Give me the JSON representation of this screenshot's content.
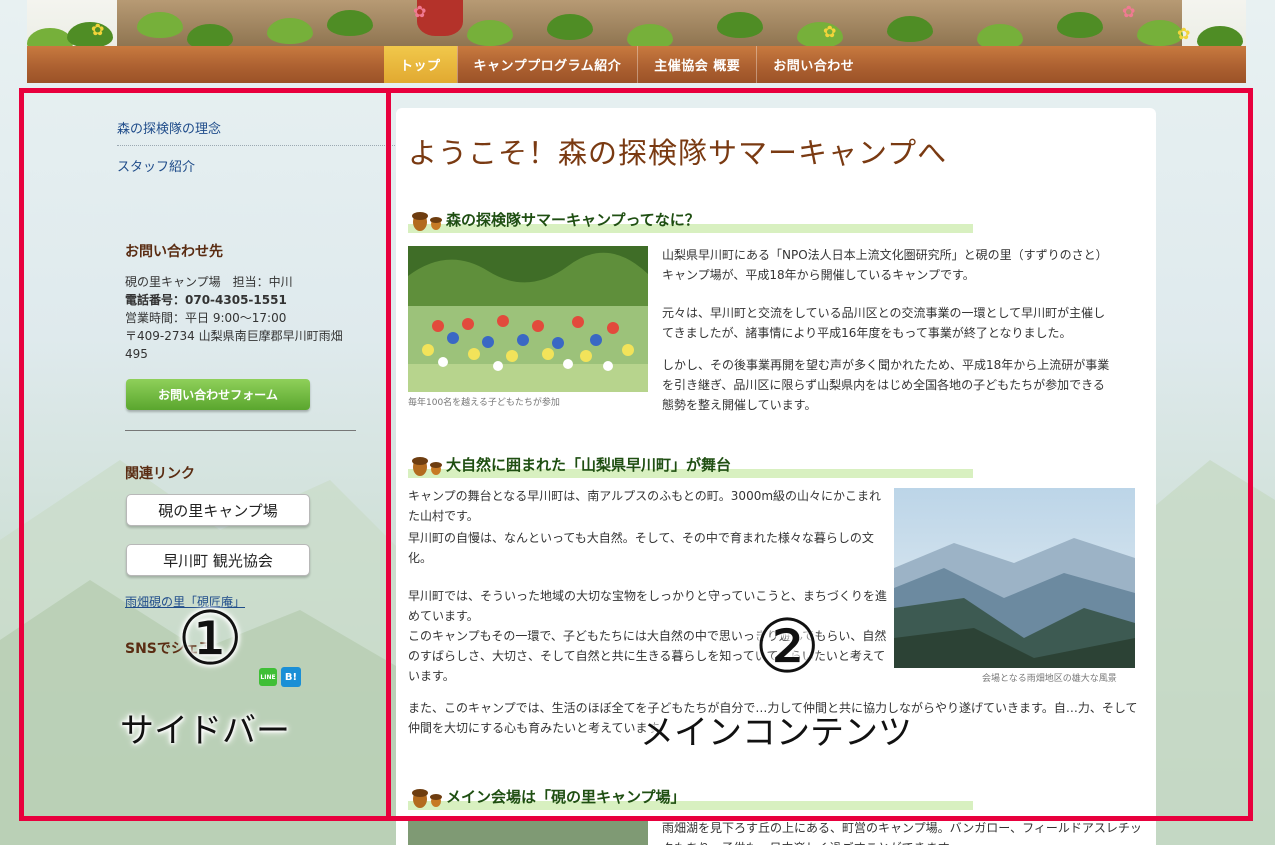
{
  "nav": {
    "items": [
      {
        "label": "トップ",
        "active": true
      },
      {
        "label": "キャンププログラム紹介",
        "active": false
      },
      {
        "label": "主催協会 概要",
        "active": false
      },
      {
        "label": "お問い合わせ",
        "active": false
      }
    ]
  },
  "sidebar": {
    "links": [
      "森の探検隊の理念",
      "スタッフ紹介"
    ],
    "contact": {
      "heading": "お問い合わせ先",
      "line1": "硯の里キャンプ場　担当：中川",
      "phone": "電話番号：070-4305-1551",
      "hours": "営業時間：平日 9:00〜17:00",
      "address1": "〒409-2734 山梨県南巨摩郡早川町雨畑",
      "address2": "495",
      "form_button": "お問い合わせフォーム"
    },
    "related": {
      "heading": "関連リンク",
      "buttons": [
        "硯の里キャンプ場",
        "早川町 観光協会"
      ],
      "text_link": "雨畑硯の里「硯匠庵」"
    },
    "sns": {
      "heading": "SNSでシェア",
      "icons": [
        "line-icon",
        "hatena-bookmark-icon"
      ],
      "line_label": "LINE",
      "hatena_label": "B!"
    }
  },
  "main": {
    "title": "ようこそ！森の探検隊サマーキャンプへ",
    "sections": [
      {
        "heading": "森の探検隊サマーキャンプってなに？",
        "photo_caption": "毎年100名を越える子どもたちが参加",
        "p1": "山梨県早川町にある「NPO法人日本上流文化圏研究所」と硯の里（すずりのさと）キャンプ場が、平成18年から開催しているキャンプです。",
        "p2": "元々は、早川町と交流をしている品川区との交流事業の一環として早川町が主催してきましたが、諸事情により平成16年度をもって事業が終了となりました。",
        "p3": "しかし、その後事業再開を望む声が多く聞かれたため、平成18年から上流研が事業を引き継ぎ、品川区に限らず山梨県内をはじめ全国各地の子どもたちが参加できる態勢を整え開催しています。"
      },
      {
        "heading": "大自然に囲まれた「山梨県早川町」が舞台",
        "photo_caption": "会場となる雨畑地区の雄大な風景",
        "p1": "キャンプの舞台となる早川町は、南アルプスのふもとの町。3000m級の山々にかこまれた山村です。",
        "p2": "早川町の自慢は、なんといっても大自然。そして、その中で育まれた様々な暮らしの文化。",
        "p3": "早川町では、そういった地域の大切な宝物をしっかりと守っていこうと、まちづくりを進めています。",
        "p4": "このキャンプもその一環で、子どもたちには大自然の中で思いっきり遊んでもらい、自然のすばらしさ、大切さ、そして自然と共に生きる暮らしを知っていてもらいたいと考えています。",
        "p5": "また、このキャンプでは、生活のほぼ全てを子どもたちが自分で…力して仲間と共に協力しながらやり遂げていきます。自…力、そして仲間を大切にする心も育みたいと考えています。"
      },
      {
        "heading": "メイン会場は「硯の里キャンプ場」",
        "p1": "雨畑湖を見下ろす丘の上にある、町営のキャンプ場。バンガロー、フィールドアスレチックもあり、子供も一日中楽しく過ごすことができます。"
      }
    ]
  },
  "annotations": {
    "sidebar_number": "①",
    "sidebar_label": "サイドバー",
    "main_number": "②",
    "main_label": "メインコンテンツ",
    "frame_color": "#e8003d"
  }
}
